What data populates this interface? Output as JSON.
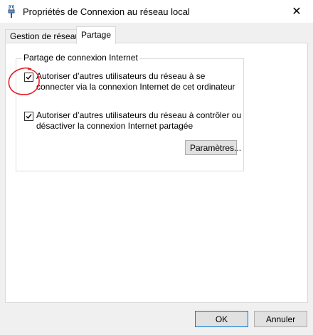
{
  "window": {
    "title": "Propriétés de Connexion au réseau local",
    "close_glyph": "✕"
  },
  "tabs": [
    {
      "label": "Gestion de réseau",
      "active": false
    },
    {
      "label": "Partage",
      "active": true
    }
  ],
  "sharing": {
    "group_title": "Partage de connexion Internet",
    "options": [
      {
        "label": "Autoriser d’autres utilisateurs du réseau à se connecter via la connexion Internet de cet ordinateur",
        "checked": true
      },
      {
        "label": "Autoriser d’autres utilisateurs du réseau à contrôler ou désactiver la connexion Internet partagée",
        "checked": true
      }
    ],
    "settings_button": "Paramètres..."
  },
  "footer": {
    "ok_label": "OK",
    "cancel_label": "Annuler"
  },
  "colors": {
    "annotation": "#e8141b",
    "focus_border": "#0078d7"
  },
  "icons": {
    "title": "network-cable-icon",
    "checkmark": "checkmark-icon"
  }
}
